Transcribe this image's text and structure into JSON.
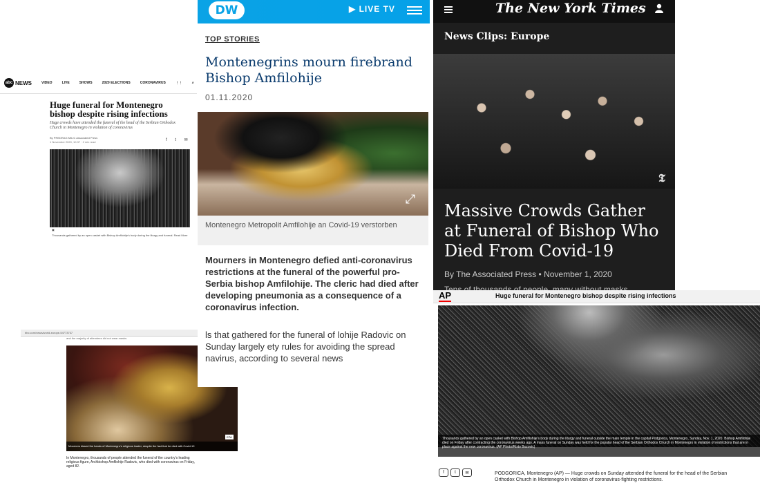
{
  "abc": {
    "logo": "abc",
    "logo_text": "NEWS",
    "nav": [
      "VIDEO",
      "LIVE",
      "SHOWS",
      "2020 ELECTIONS",
      "CORONAVIRUS"
    ],
    "title": "Huge funeral for Montenegro bishop despite rising infections",
    "subtitle": "Huge crowds have attended the funeral of the head of the Serbian Orthodox Church in Montenegro in violation of coronavirus",
    "byline": "By PREDRAG MILIC Associated Press",
    "date": "1 November 2020, 10:37 · 2 min read",
    "caption": "Thousands gathered by an open casket with Bishop Amfilohije's body during the liturgy and funeral. Read More"
  },
  "bbc": {
    "url": "bbc.com/news/world-europe-54773737",
    "prev_text": "and the majority of attendees did not wear masks.",
    "photo_caption": "Mourners kissed the hands of Montenegro's religious leader, despite the fact that he died with Covid-19",
    "photo_credit": "EPA",
    "body": "In Montenegro, thousands of people attended the funeral of the country's leading religious figure, Archbishop Amfilohije Radovic, who died with coronavirus on Friday, aged 82."
  },
  "dw": {
    "logo": "DW",
    "live_label": "▶ LIVE TV",
    "section": "TOP STORIES",
    "headline": "Montenegrins mourn firebrand Bishop Amfilohije",
    "date": "01.11.2020",
    "photo_caption": "Montenegro Metropolit Amfilohije an Covid-19 verstorben",
    "lead": "Mourners in Montenegro defied anti-coronavirus restrictions at the funeral of the powerful pro-Serbia bishop Amfilohije. The cleric had died after developing pneumonia as a consequence of a coronavirus infection.",
    "body": "ls that gathered for the funeral of lohije Radovic on Sunday largely ety rules for avoiding the spread navirus, according to several news"
  },
  "nyt": {
    "masthead": "The New York Times",
    "section": "News Clips: Europe",
    "headline": "Massive Crowds Gather at Funeral of Bishop Who Died From Covid-19",
    "byline": "By The Associated Press",
    "date": "November 1, 2020",
    "body": "Tens of thousands of people, many without masks"
  },
  "ap": {
    "logo": "AP",
    "title": "Huge funeral for Montenegro bishop despite rising infections",
    "photo_caption": "Thousands gathered by an open casket with Bishop Amfilohije's body during the liturgy and funeral outside the main temple in the capital Podgorica, Montenegro, Sunday, Nov. 1, 2020. Bishop Amfilohije died on Friday after contracting the coronavirus weeks ago. A mass funeral on Sunday was held for the popular head of the Serbian Orthodox Church in Montenegro in violation of restrictions that are in place against the new coronavirus. (AP Photo/Risto Bozovic)",
    "body": "PODGORICA, Montenegro (AP) — Huge crowds on Sunday attended the funeral for the head of the Serbian Orthodox Church in Montenegro in violation of coronavirus-fighting restrictions."
  }
}
